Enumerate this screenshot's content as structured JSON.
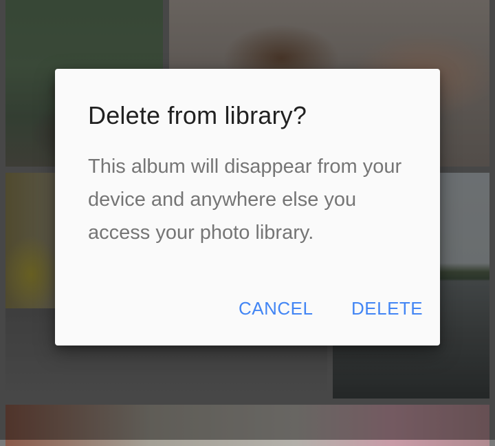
{
  "background": {
    "tiles": [
      {
        "id": "elephants",
        "description": ""
      },
      {
        "id": "food"
      },
      {
        "id": "jeepney"
      },
      {
        "id": "sea"
      },
      {
        "id": "street"
      }
    ]
  },
  "dialog": {
    "title": "Delete from library?",
    "body": "This album will disappear from your device and anywhere else you access your photo library.",
    "cancel_label": "CANCEL",
    "delete_label": "DELETE",
    "accent_color": "#4285f4"
  }
}
